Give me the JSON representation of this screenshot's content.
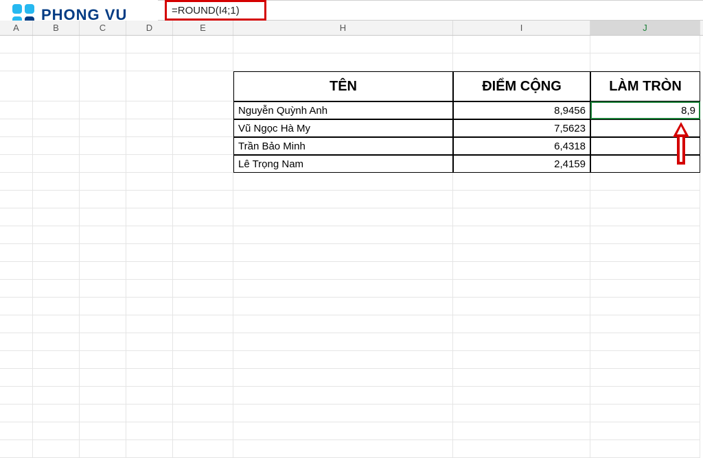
{
  "logo_text": "PHONG VU",
  "formula": "=ROUND(I4;1)",
  "columns": {
    "A": "A",
    "B": "B",
    "C": "C",
    "D": "D",
    "E": "E",
    "H": "H",
    "I": "I",
    "J": "J"
  },
  "headers": {
    "name": "TÊN",
    "score": "ĐIỂM CỘNG",
    "round": "LÀM TRÒN"
  },
  "rows": [
    {
      "name": "Nguyễn Quỳnh Anh",
      "score": "8,9456",
      "round": "8,9"
    },
    {
      "name": "Vũ Ngọc Hà My",
      "score": "7,5623",
      "round": ""
    },
    {
      "name": "Trần Bảo Minh",
      "score": "6,4318",
      "round": ""
    },
    {
      "name": "Lê Trọng Nam",
      "score": "2,4159",
      "round": ""
    }
  ],
  "chart_data": {
    "type": "table",
    "title": "ROUND function example",
    "columns": [
      "TÊN",
      "ĐIỂM CỘNG",
      "LÀM TRÒN"
    ],
    "rows": [
      [
        "Nguyễn Quỳnh Anh",
        8.9456,
        8.9
      ],
      [
        "Vũ Ngọc Hà My",
        7.5623,
        null
      ],
      [
        "Trần Bảo Minh",
        6.4318,
        null
      ],
      [
        "Lê Trọng Nam",
        2.4159,
        null
      ]
    ],
    "formula": "=ROUND(I4;1)",
    "active_cell": "J4"
  }
}
